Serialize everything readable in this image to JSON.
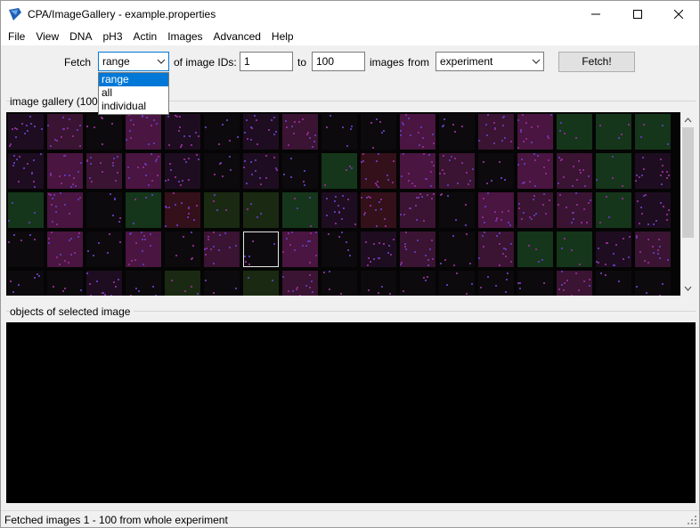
{
  "window": {
    "title": "CPA/ImageGallery - example.properties"
  },
  "menu": [
    "File",
    "View",
    "DNA",
    "pH3",
    "Actin",
    "Images",
    "Advanced",
    "Help"
  ],
  "toolbar": {
    "fetch_label": "Fetch",
    "fetch_mode": "range",
    "of_image_ids_label": "of image IDs:",
    "from_id": "1",
    "to_label": "to",
    "to_id": "100",
    "images_label": "images",
    "from_label": "from",
    "source": "experiment",
    "fetch_button": "Fetch!"
  },
  "dropdown": {
    "options": [
      "range",
      "all",
      "individual"
    ],
    "selected_index": 0
  },
  "gallery": {
    "label": "image gallery (100)",
    "rows": 5,
    "cols": 17,
    "selected_tile": [
      3,
      6
    ],
    "tile_colors": {
      "dark_purple": "#1e0d20",
      "purple": "#3a1432",
      "magenta": "#4a1540",
      "green": "#15361a",
      "dark_green": "#1a2a12",
      "dark": "#0d0a0d",
      "red": "#34101a"
    }
  },
  "objects_panel": {
    "label": "objects of selected image"
  },
  "status": {
    "text": "Fetched images 1 - 100  from whole experiment"
  }
}
